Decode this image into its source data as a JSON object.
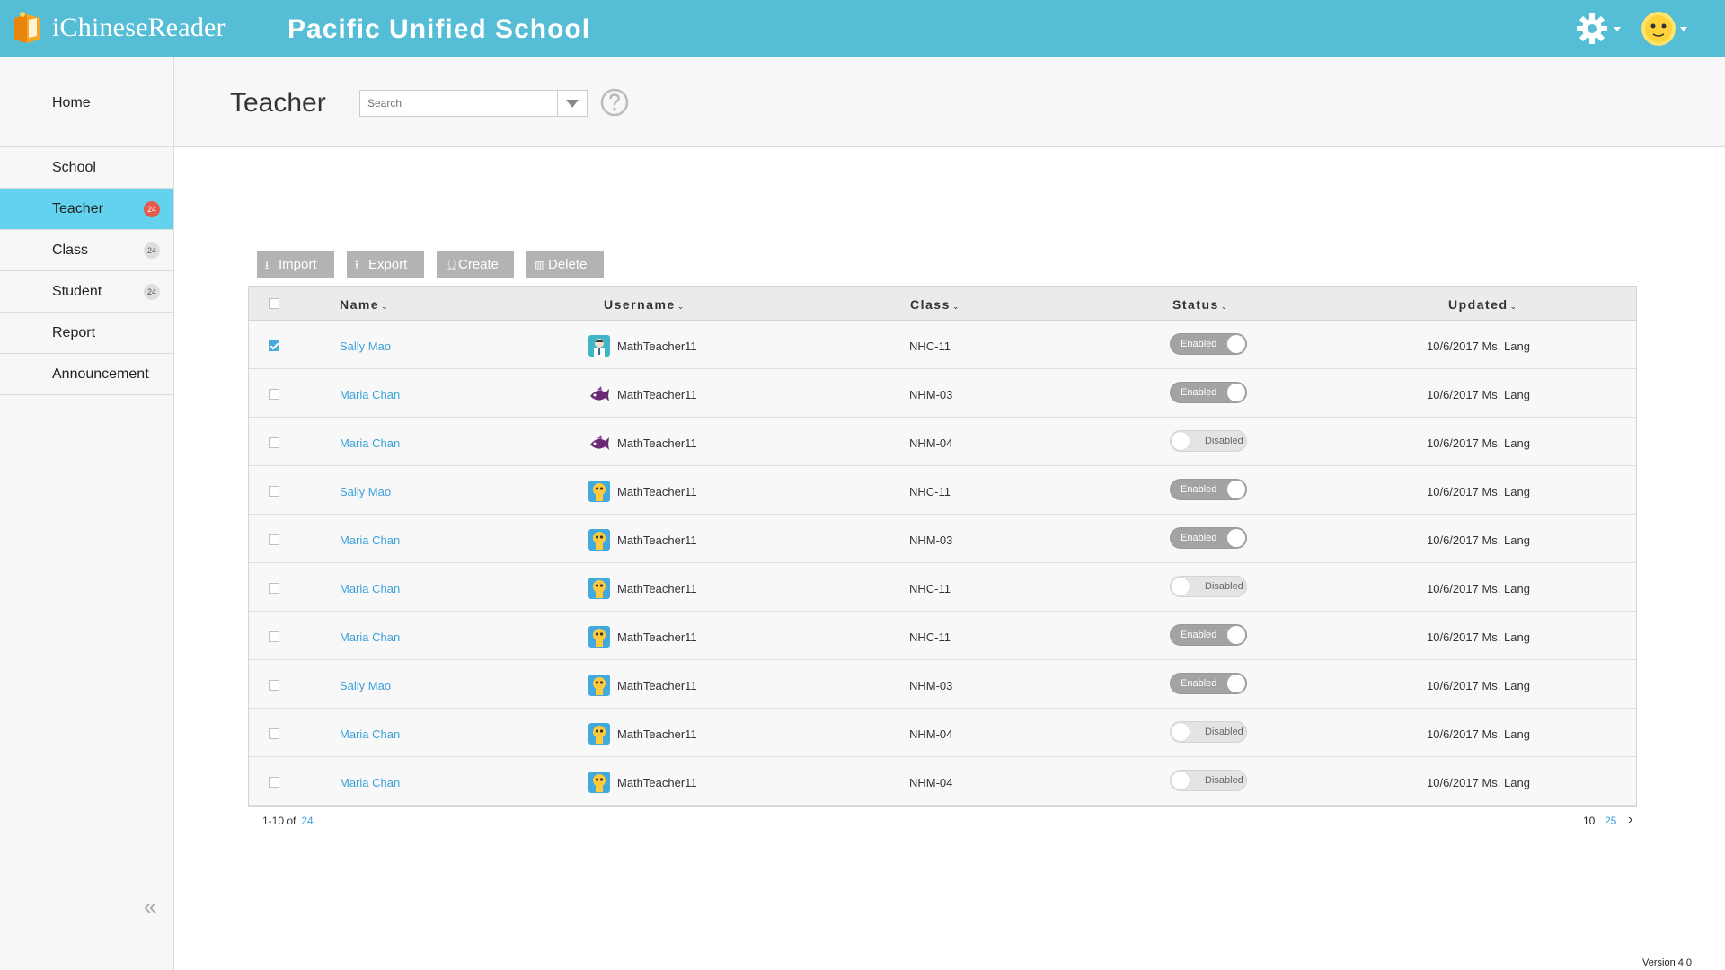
{
  "header": {
    "brand": "iChineseReader",
    "school_title": "Pacific Unified School",
    "colors": {
      "topbar": "#55bdd5",
      "active_nav": "#63d2ee",
      "badge_active": "#e55a4a",
      "link": "#3ca0d8"
    }
  },
  "sidebar": {
    "items": [
      {
        "label": "Home"
      },
      {
        "label": "School"
      },
      {
        "label": "Teacher",
        "count": "24"
      },
      {
        "label": "Class",
        "count": "24"
      },
      {
        "label": "Student",
        "count": "24"
      },
      {
        "label": "Report"
      },
      {
        "label": "Announcement"
      }
    ],
    "collapse_icon": "double-chevron-left-icon",
    "collapse_glyph": "«"
  },
  "page": {
    "title": "Teacher",
    "search_placeholder": "Search"
  },
  "toolbar": {
    "import": "Import",
    "export": "Export",
    "create": "Create",
    "delete": "Delete"
  },
  "table": {
    "columns": {
      "name": "Name",
      "username": "Username",
      "class": "Class",
      "status": "Status",
      "updated": "Updated"
    },
    "rows": [
      {
        "checked": true,
        "name": "Sally Mao",
        "avatar": "teacher-avatar-icon",
        "username": "MathTeacher11",
        "class": "NHC-11",
        "status": "Enabled",
        "updated": "10/6/2017 Ms. Lang"
      },
      {
        "checked": false,
        "name": "Maria Chan",
        "avatar": "fish-avatar-icon",
        "username": "MathTeacher11",
        "class": "NHM-03",
        "status": "Enabled",
        "updated": "10/6/2017 Ms. Lang"
      },
      {
        "checked": false,
        "name": "Maria Chan",
        "avatar": "fish-avatar-icon",
        "username": "MathTeacher11",
        "class": "NHM-04",
        "status": "Disabled",
        "updated": "10/6/2017 Ms. Lang"
      },
      {
        "checked": false,
        "name": "Sally Mao",
        "avatar": "robot-avatar-icon",
        "username": "MathTeacher11",
        "class": "NHC-11",
        "status": "Enabled",
        "updated": "10/6/2017 Ms. Lang"
      },
      {
        "checked": false,
        "name": "Maria Chan",
        "avatar": "robot-avatar-icon",
        "username": "MathTeacher11",
        "class": "NHM-03",
        "status": "Enabled",
        "updated": "10/6/2017 Ms. Lang"
      },
      {
        "checked": false,
        "name": "Maria Chan",
        "avatar": "robot-avatar-icon",
        "username": "MathTeacher11",
        "class": "NHC-11",
        "status": "Disabled",
        "updated": "10/6/2017 Ms. Lang"
      },
      {
        "checked": false,
        "name": "Maria Chan",
        "avatar": "robot-avatar-icon",
        "username": "MathTeacher11",
        "class": "NHC-11",
        "status": "Enabled",
        "updated": "10/6/2017 Ms. Lang"
      },
      {
        "checked": false,
        "name": "Sally Mao",
        "avatar": "robot-avatar-icon",
        "username": "MathTeacher11",
        "class": "NHM-03",
        "status": "Enabled",
        "updated": "10/6/2017 Ms. Lang"
      },
      {
        "checked": false,
        "name": "Maria Chan",
        "avatar": "robot-avatar-icon",
        "username": "MathTeacher11",
        "class": "NHM-04",
        "status": "Disabled",
        "updated": "10/6/2017 Ms. Lang"
      },
      {
        "checked": false,
        "name": "Maria Chan",
        "avatar": "robot-avatar-icon",
        "username": "MathTeacher11",
        "class": "NHM-04",
        "status": "Disabled",
        "updated": "10/6/2017 Ms. Lang"
      }
    ]
  },
  "pager": {
    "range": "1-10 of",
    "total": "24",
    "page_size_current": "10",
    "page_size_alt": "25",
    "next_glyph": "›"
  },
  "footer": {
    "version": "Version 4.0"
  }
}
